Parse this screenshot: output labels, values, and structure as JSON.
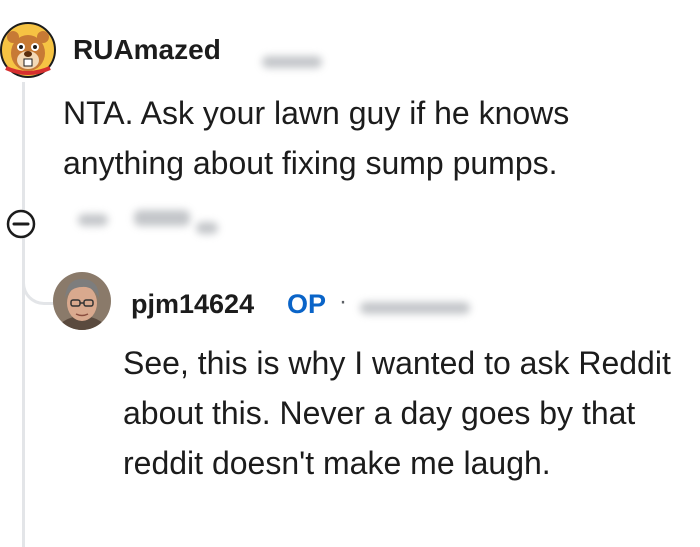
{
  "comment": {
    "author": "RUAmazed",
    "body": "NTA. Ask your lawn guy if he knows anything about fixing sump pumps.",
    "avatar_icon": "beaver-mascot-avatar-icon",
    "collapse_icon": "collapse-minus-icon"
  },
  "reply": {
    "author": "pjm14624",
    "badge": "OP",
    "separator": "·",
    "body": "See, this is why I wanted to ask Reddit about this. Never a day goes by that reddit doesn't make me laugh.",
    "avatar_icon": "user-photo-avatar-icon"
  },
  "colors": {
    "op_badge": "#0a64c8",
    "thread_line": "#e3e5e8",
    "text": "#1c1c1c"
  }
}
